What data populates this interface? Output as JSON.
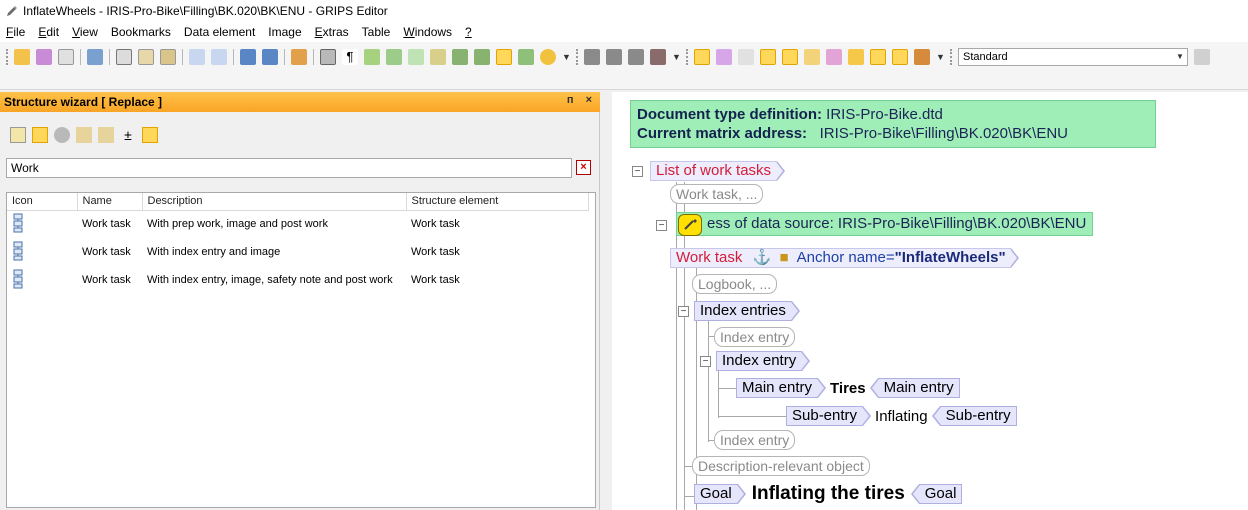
{
  "window": {
    "title": "InflateWheels - IRIS-Pro-Bike\\Filling\\BK.020\\BK\\ENU - GRIPS Editor"
  },
  "menu": [
    {
      "label": "File",
      "accel": "F"
    },
    {
      "label": "Edit",
      "accel": "E"
    },
    {
      "label": "View",
      "accel": "V"
    },
    {
      "label": "Bookmarks",
      "accel": ""
    },
    {
      "label": "Data element",
      "accel": ""
    },
    {
      "label": "Image",
      "accel": ""
    },
    {
      "label": "Extras",
      "accel": "E"
    },
    {
      "label": "Table",
      "accel": ""
    },
    {
      "label": "Windows",
      "accel": "W"
    },
    {
      "label": "?",
      "accel": "?"
    }
  ],
  "toolbar": {
    "style_select_value": "Standard"
  },
  "wizard": {
    "title": "Structure wizard [ Replace ]",
    "pin_label": "3",
    "close_label": "×",
    "search_value": "Work",
    "clear_label": "×",
    "columns": [
      "Icon",
      "Name",
      "Description",
      "Structure element"
    ],
    "rows": [
      {
        "name": "Work task",
        "description": "With prep work, image and post work",
        "structure_element": "Work task"
      },
      {
        "name": "Work task",
        "description": "With index entry and image",
        "structure_element": "Work task"
      },
      {
        "name": "Work task",
        "description": "With index entry, image, safety note and post work",
        "structure_element": "Work task"
      }
    ]
  },
  "document": {
    "dtd_label": "Document type definition:",
    "dtd_value": "IRIS-Pro-Bike.dtd",
    "matrix_label": "Current matrix address:",
    "matrix_value": "IRIS-Pro-Bike\\Filling\\BK.020\\BK\\ENU",
    "tree": {
      "list_of_work_tasks": "List of work tasks",
      "work_task_empty": "Work task, ...",
      "address_note": "ess of data source: IRIS-Pro-Bike\\Filling\\BK.020\\BK\\ENU",
      "work_task": "Work task",
      "anchor_label": "Anchor name=",
      "anchor_value": "\"InflateWheels\"",
      "logbook_empty": "Logbook, ...",
      "index_entries": "Index entries",
      "index_entry_empty_1": "Index entry",
      "index_entry": "Index entry",
      "main_entry_open": "Main entry",
      "main_entry_text": "Tires",
      "main_entry_close": "Main entry",
      "sub_entry_open": "Sub-entry",
      "sub_entry_text": "Inflating",
      "sub_entry_close": "Sub-entry",
      "index_entry_empty_2": "Index entry",
      "description_object": "Description-relevant object",
      "goal_open": "Goal",
      "goal_text": "Inflating the tires",
      "goal_close": "Goal"
    }
  }
}
